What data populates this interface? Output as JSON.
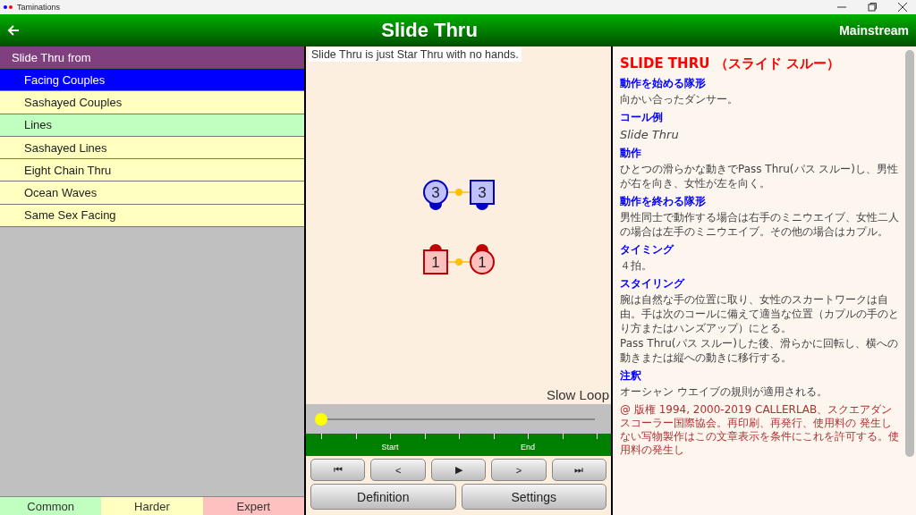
{
  "window": {
    "title": "Taminations"
  },
  "header": {
    "title": "Slide Thru",
    "level": "Mainstream"
  },
  "formations": {
    "title": "Slide Thru from",
    "items": [
      {
        "label": "Facing Couples",
        "selected": true,
        "color": "#0000ff"
      },
      {
        "label": "Sashayed Couples",
        "selected": false,
        "color": "#ffffc0"
      },
      {
        "label": "Lines",
        "selected": false,
        "color": "#c0ffc0"
      },
      {
        "label": "Sashayed Lines",
        "selected": false,
        "color": "#ffffc0"
      },
      {
        "label": "Eight Chain Thru",
        "selected": false,
        "color": "#ffffc0"
      },
      {
        "label": "Ocean Waves",
        "selected": false,
        "color": "#ffffc0"
      },
      {
        "label": "Same Sex Facing",
        "selected": false,
        "color": "#ffffc0"
      }
    ]
  },
  "difficulty_tabs": [
    {
      "label": "Common",
      "color": "#c0ffc0"
    },
    {
      "label": "Harder",
      "color": "#ffffc0"
    },
    {
      "label": "Expert",
      "color": "#ffc0c0"
    }
  ],
  "animation": {
    "caption": "Slide Thru is just Star Thru with no hands.",
    "loop_label": "Slow Loop",
    "dancers": [
      {
        "kind": "girl",
        "number": "3",
        "color": "#0000c0"
      },
      {
        "kind": "boy",
        "number": "3",
        "color": "#0000c0"
      },
      {
        "kind": "boy",
        "number": "1",
        "color": "#c00000"
      },
      {
        "kind": "girl",
        "number": "1",
        "color": "#c00000"
      }
    ],
    "slider": {
      "level": 0
    },
    "tick_labels": [
      "Start",
      "End"
    ],
    "controls": [
      "⏮",
      "<",
      "▶",
      ">",
      "⏭"
    ],
    "buttons": [
      "Definition",
      "Settings"
    ]
  },
  "definition": {
    "title": "SLIDE THRU （スライド スルー）",
    "sections": [
      {
        "kind": "text",
        "heading": "動作を始める隊形",
        "paragraphs": [
          "向かい合ったダンサー。"
        ]
      },
      {
        "kind": "example",
        "heading": "コール例",
        "paragraphs": [
          "Slide Thru"
        ]
      },
      {
        "kind": "text",
        "heading": "動作",
        "paragraphs": [
          "ひとつの滑らかな動きでPass Thru(パス スルー)し、男性が右を向き、女性が左を向く。"
        ]
      },
      {
        "kind": "text",
        "heading": "動作を終わる隊形",
        "paragraphs": [
          "男性同士で動作する場合は右手のミニウエイブ、女性二人の場合は左手のミニウエイブ。その他の場合はカプル。"
        ]
      },
      {
        "kind": "text",
        "heading": "タイミング",
        "paragraphs": [
          "４拍。"
        ]
      },
      {
        "kind": "text",
        "heading": "スタイリング",
        "paragraphs": [
          "腕は自然な手の位置に取り、女性のスカートワークは自由。手は次のコールに備えて適当な位置（カプルの手のとり方またはハンズアップ）にとる。",
          "Pass Thru(パス スルー)した後、滑らかに回転し、横への動きまたは縦への動きに移行する。"
        ]
      },
      {
        "kind": "text",
        "heading": "注釈",
        "paragraphs": [
          "オーシャン ウエイブの規則が適用される。"
        ]
      }
    ],
    "copyright": "@ 版権 1994, 2000-2019 CALLERLAB、スクエアダンスコーラー国際協会。再印刷、再発行、使用料の 発生しない写物製作はこの文章表示を条件にこれを許可する。使用料の発生し"
  }
}
